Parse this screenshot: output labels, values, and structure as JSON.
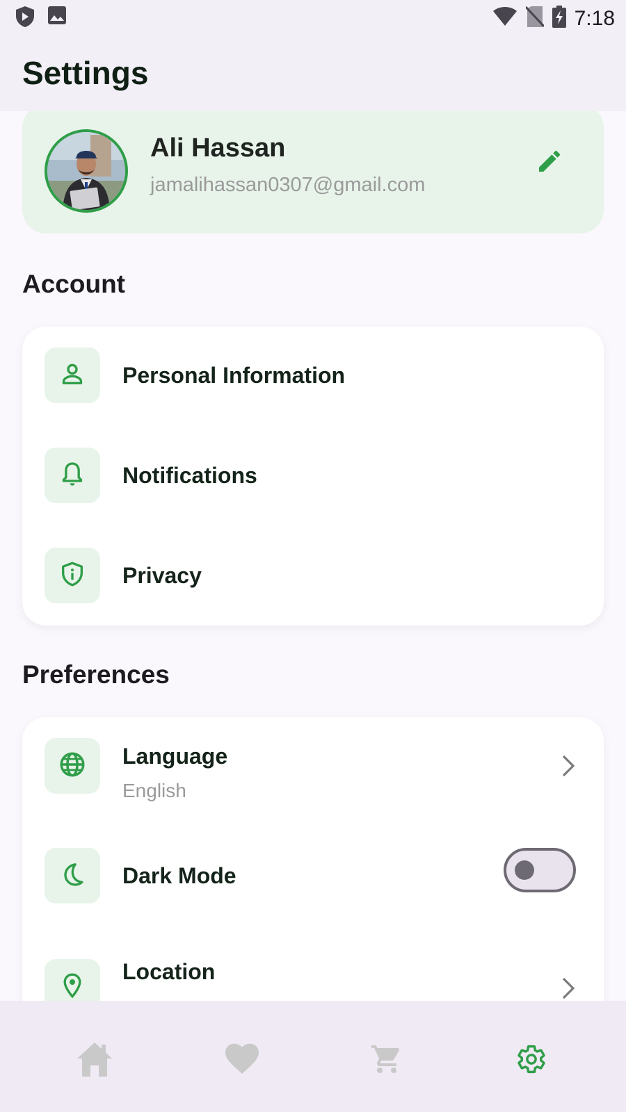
{
  "status_bar": {
    "time": "7:18"
  },
  "app_bar": {
    "title": "Settings"
  },
  "profile": {
    "name": "Ali Hassan",
    "email": "jamalihassan0307@gmail.com"
  },
  "account": {
    "title": "Account",
    "items": [
      {
        "label": "Personal Information",
        "icon": "person-icon"
      },
      {
        "label": "Notifications",
        "icon": "bell-icon"
      },
      {
        "label": "Privacy",
        "icon": "shield-icon"
      }
    ]
  },
  "preferences": {
    "title": "Preferences",
    "items": [
      {
        "label": "Language",
        "value": "English",
        "icon": "globe-icon"
      },
      {
        "label": "Dark Mode",
        "icon": "moon-icon",
        "toggle_on": false
      },
      {
        "label": "Location",
        "icon": "location-pin-icon"
      }
    ]
  },
  "bottom_nav": {
    "items": [
      {
        "icon": "home-icon",
        "active": false
      },
      {
        "icon": "heart-icon",
        "active": false
      },
      {
        "icon": "cart-icon",
        "active": false
      },
      {
        "icon": "gear-icon",
        "active": true
      }
    ]
  },
  "colors": {
    "accent": "#2f9e48",
    "accent_bg": "#e8f4ea",
    "inactive_nav": "#c9c9c9"
  }
}
